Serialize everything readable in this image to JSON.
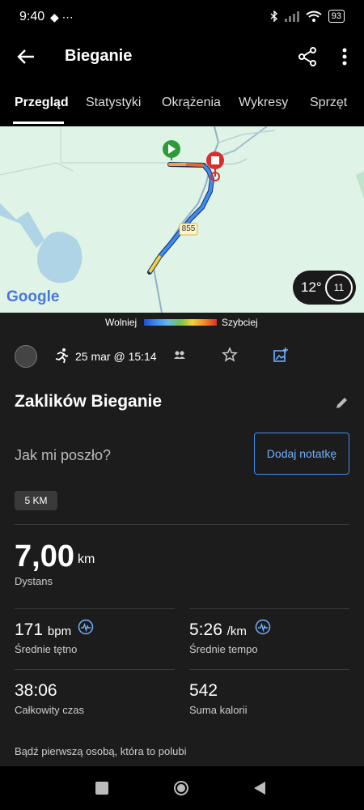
{
  "status": {
    "time": "9:40",
    "left_icons": "◆ ⋯",
    "battery": "93"
  },
  "appbar": {
    "title": "Bieganie"
  },
  "tabs": [
    "Przegląd",
    "Statystyki",
    "Okrążenia",
    "Wykresy",
    "Sprzęt"
  ],
  "map": {
    "road_label": "855",
    "google": "Google",
    "temp": "12°",
    "wind": "11"
  },
  "legend": {
    "slow": "Wolniej",
    "fast": "Szybciej"
  },
  "activity": {
    "date": "25 mar @ 15:14",
    "title": "Zaklików Bieganie",
    "how_prompt": "Jak mi poszło?",
    "add_note": "Dodaj notatkę",
    "chip": "5 KM",
    "distance": {
      "value": "7,00",
      "unit": "km",
      "label": "Dystans"
    },
    "hr": {
      "value": "171",
      "unit": "bpm",
      "label": "Średnie tętno"
    },
    "pace": {
      "value": "5:26",
      "unit": "/km",
      "label": "Średnie tempo"
    },
    "time": {
      "value": "38:06",
      "label": "Całkowity czas"
    },
    "calories": {
      "value": "542",
      "label": "Suma kalorii"
    },
    "like_text": "Bądź pierwszą osobą, która to polubi"
  },
  "colors": {
    "accent": "#3d8ff0",
    "route_start": "#2e9b3a",
    "route_end": "#d9302b"
  }
}
